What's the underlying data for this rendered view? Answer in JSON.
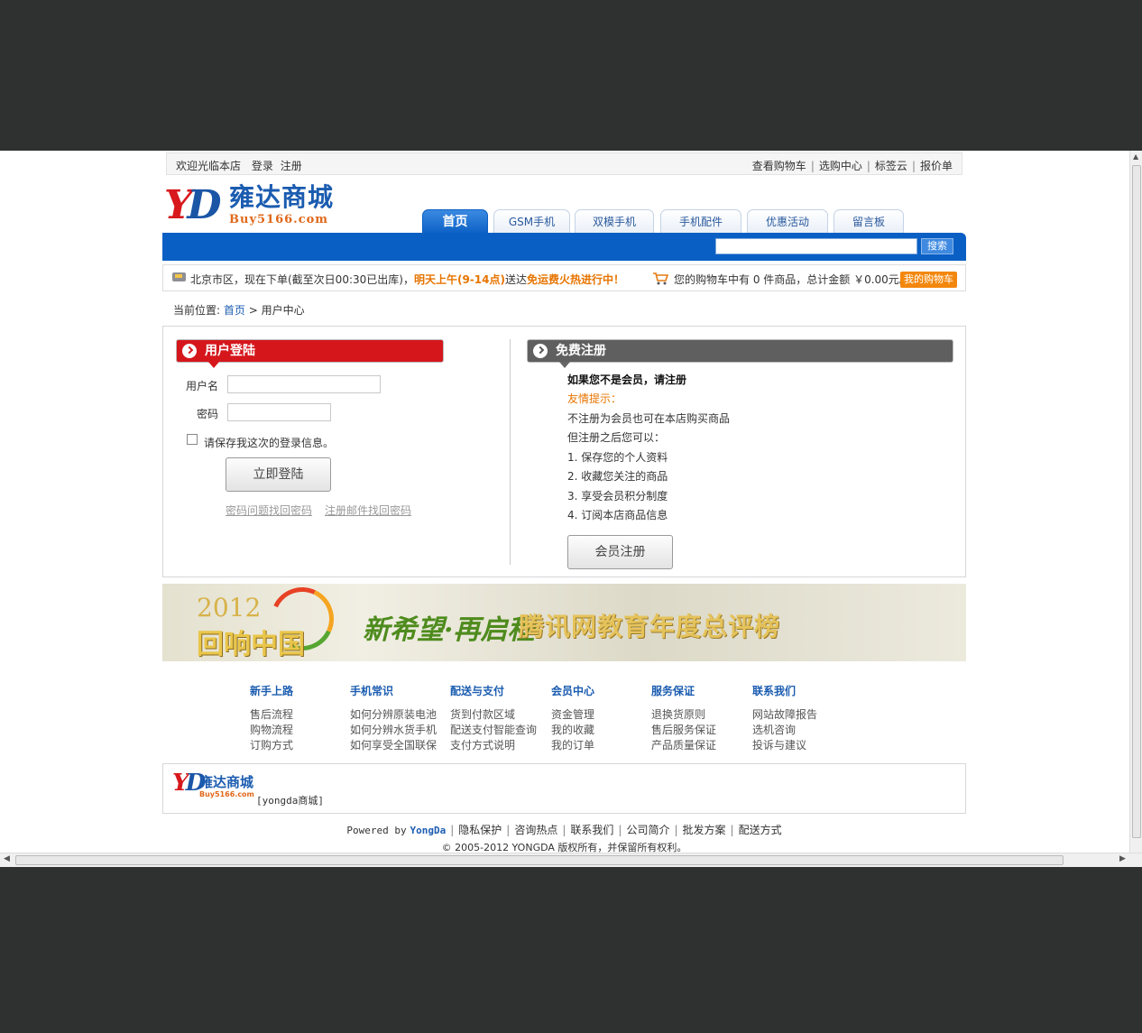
{
  "topbar": {
    "welcome": "欢迎光临本店",
    "login": "登录",
    "register": "注册",
    "links": [
      "查看购物车",
      "选购中心",
      "标签云",
      "报价单"
    ]
  },
  "logo": {
    "mark": "YD",
    "cn": "雍达商城",
    "en": "Buy5166.com"
  },
  "nav": {
    "tabs": [
      "首页",
      "GSM手机",
      "双模手机",
      "手机配件",
      "优惠活动",
      "留言板"
    ],
    "active": "首页",
    "search_button": "搜索",
    "search_value": ""
  },
  "notice": {
    "text_a": "北京市区，现在下单(截至次日00:30已出库)，",
    "text_b": "明天上午(9-14点)",
    "text_c": "送达",
    "text_d": "免运费火热进行中！",
    "cart_info": "您的购物车中有 0 件商品，总计金额 ￥0.00元。",
    "my_cart": "我的购物车"
  },
  "breadcrumb": {
    "prefix": "当前位置:",
    "home": "首页",
    "sep": ">",
    "current": "用户中心"
  },
  "login": {
    "title": "用户登陆",
    "username_label": "用户名",
    "password_label": "密码",
    "remember": "请保存我这次的登录信息。",
    "submit": "立即登陆",
    "link_question": "密码问题找回密码",
    "link_email": "注册邮件找回密码"
  },
  "register": {
    "title": "免费注册",
    "lead": "如果您不是会员，请注册",
    "tip": "友情提示：",
    "line1": "不注册为会员也可在本店购买商品",
    "line2": "但注册之后您可以：",
    "benefits": [
      "1.  保存您的个人资料",
      "2.  收藏您关注的商品",
      "3.  享受会员积分制度",
      "4.  订阅本店商品信息"
    ],
    "button": "会员注册"
  },
  "banner": {
    "year": "2012",
    "slogan": "回响中国",
    "hope": "新希望·再启程",
    "title": "腾讯网教育年度总评榜"
  },
  "footer_columns": [
    {
      "title": "新手上路",
      "items": [
        "售后流程",
        "购物流程",
        "订购方式"
      ]
    },
    {
      "title": "手机常识",
      "items": [
        "如何分辨原装电池",
        "如何分辨水货手机",
        "如何享受全国联保"
      ]
    },
    {
      "title": "配送与支付",
      "items": [
        "货到付款区域",
        "配送支付智能查询",
        "支付方式说明"
      ]
    },
    {
      "title": "会员中心",
      "items": [
        "资金管理",
        "我的收藏",
        "我的订单"
      ]
    },
    {
      "title": "服务保证",
      "items": [
        "退换货原则",
        "售后服务保证",
        "产品质量保证"
      ]
    },
    {
      "title": "联系我们",
      "items": [
        "网站故障报告",
        "选机咨询",
        "投诉与建议"
      ]
    }
  ],
  "footer": {
    "shop_name": "[yongda商城]",
    "powered_by": "Powered by",
    "brand": "YongDa",
    "links": [
      "隐私保护",
      "咨询热点",
      "联系我们",
      "公司简介",
      "批发方案",
      "配送方式"
    ],
    "copyright": "© 2005-2012 YONGDA 版权所有，并保留所有权利。"
  },
  "colors": {
    "brand_blue": "#0a5fc4",
    "brand_red": "#d5171c",
    "accent_orange": "#f3870d"
  }
}
